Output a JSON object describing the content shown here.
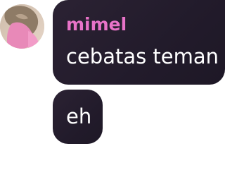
{
  "avatar": {
    "icon": "user-photo-icon"
  },
  "messages": [
    {
      "sender": "mimel",
      "text": "cebatas teman"
    },
    {
      "text": "eh"
    }
  ],
  "colors": {
    "bubble_bg": "#241c2c",
    "sender_name": "#e873c8",
    "message_text": "#ffffff",
    "background": "#ffffff"
  }
}
